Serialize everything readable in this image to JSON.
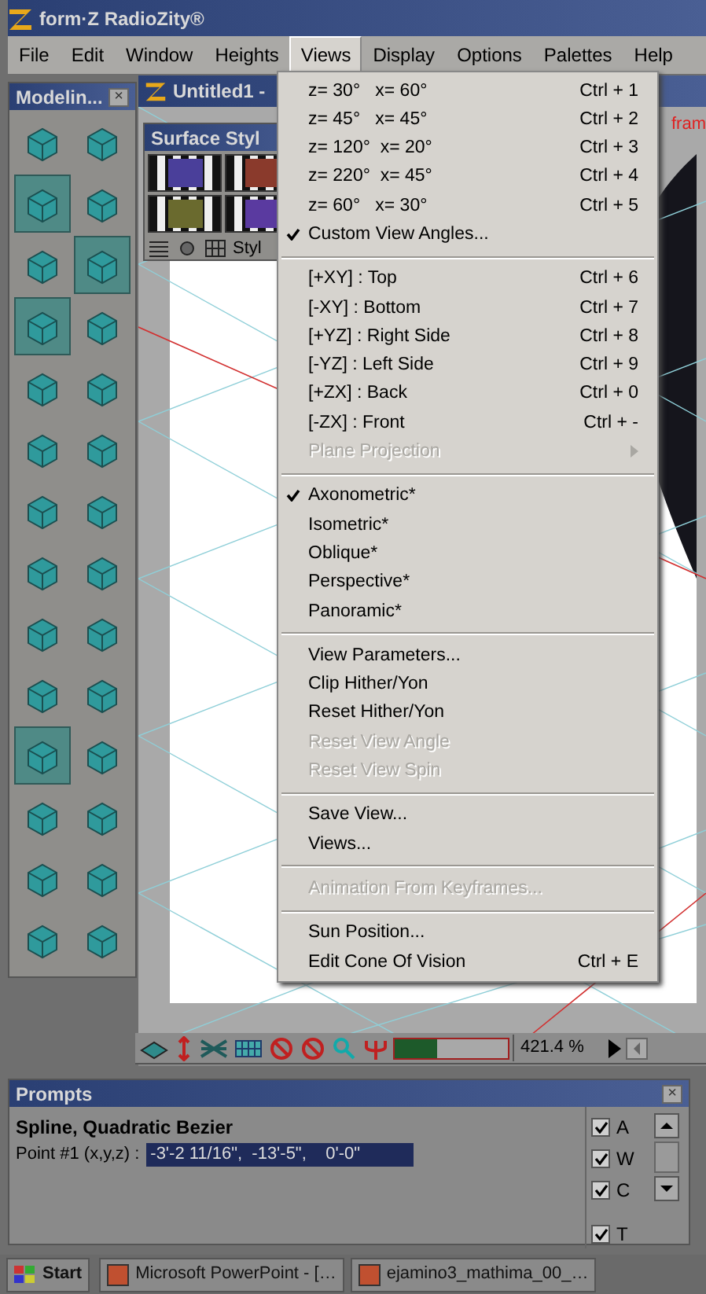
{
  "window": {
    "title": "form·Z RadioZity®"
  },
  "menubar": [
    {
      "label": "File",
      "selected": false
    },
    {
      "label": "Edit",
      "selected": false
    },
    {
      "label": "Window",
      "selected": false
    },
    {
      "label": "Heights",
      "selected": false
    },
    {
      "label": "Views",
      "selected": true
    },
    {
      "label": "Display",
      "selected": false
    },
    {
      "label": "Options",
      "selected": false
    },
    {
      "label": "Palettes",
      "selected": false
    },
    {
      "label": "Help",
      "selected": false
    }
  ],
  "tool_palette": {
    "title": "Modelin...",
    "close": "×",
    "tools": [
      {
        "selected": false
      },
      {
        "selected": false
      },
      {
        "selected": true
      },
      {
        "selected": false
      },
      {
        "selected": false
      },
      {
        "selected": true
      },
      {
        "selected": true
      },
      {
        "selected": false
      },
      {
        "selected": false
      },
      {
        "selected": false
      },
      {
        "selected": false
      },
      {
        "selected": false
      },
      {
        "selected": false
      },
      {
        "selected": false
      },
      {
        "selected": false
      },
      {
        "selected": false
      },
      {
        "selected": false
      },
      {
        "selected": false
      },
      {
        "selected": false
      },
      {
        "selected": false
      },
      {
        "selected": true
      },
      {
        "selected": false
      },
      {
        "selected": false
      },
      {
        "selected": false
      },
      {
        "selected": false
      },
      {
        "selected": false
      },
      {
        "selected": false
      },
      {
        "selected": false
      }
    ]
  },
  "document": {
    "title": "Untitled1 -",
    "label": "fram"
  },
  "surface_styles": {
    "title": "Surface Styl",
    "tab": "Styl",
    "swatches": [
      {
        "color": "#4a3f9a"
      },
      {
        "color": "#8a3a2c"
      },
      {
        "color": "#6a6a2e"
      },
      {
        "color": "#5a3aa0"
      }
    ]
  },
  "views_menu": [
    {
      "kind": "item",
      "label": "z= 30°   x= 60°",
      "shortcut": "Ctrl + 1",
      "checked": false,
      "disabled": false
    },
    {
      "kind": "item",
      "label": "z= 45°   x= 45°",
      "shortcut": "Ctrl + 2",
      "checked": false,
      "disabled": false
    },
    {
      "kind": "item",
      "label": "z= 120°  x= 20°",
      "shortcut": "Ctrl + 3",
      "checked": false,
      "disabled": false
    },
    {
      "kind": "item",
      "label": "z= 220°  x= 45°",
      "shortcut": "Ctrl + 4",
      "checked": false,
      "disabled": false
    },
    {
      "kind": "item",
      "label": "z= 60°   x= 30°",
      "shortcut": "Ctrl + 5",
      "checked": false,
      "disabled": false
    },
    {
      "kind": "item",
      "label": "Custom View Angles...",
      "checked": true,
      "disabled": false
    },
    {
      "kind": "separator"
    },
    {
      "kind": "item",
      "label": "[+XY] : Top",
      "shortcut": "Ctrl + 6",
      "checked": false,
      "disabled": false
    },
    {
      "kind": "item",
      "label": "[-XY] : Bottom",
      "shortcut": "Ctrl + 7",
      "checked": false,
      "disabled": false
    },
    {
      "kind": "item",
      "label": "[+YZ] : Right Side",
      "shortcut": "Ctrl + 8",
      "checked": false,
      "disabled": false
    },
    {
      "kind": "item",
      "label": "[-YZ] : Left Side",
      "shortcut": "Ctrl + 9",
      "checked": false,
      "disabled": false
    },
    {
      "kind": "item",
      "label": "[+ZX] : Back",
      "shortcut": "Ctrl + 0",
      "checked": false,
      "disabled": false
    },
    {
      "kind": "item",
      "label": "[-ZX] : Front",
      "shortcut": "Ctrl + -",
      "checked": false,
      "disabled": false
    },
    {
      "kind": "submenu",
      "label": "Plane Projection",
      "checked": false,
      "disabled": true
    },
    {
      "kind": "separator"
    },
    {
      "kind": "item",
      "label": "Axonometric*",
      "checked": true,
      "disabled": false
    },
    {
      "kind": "item",
      "label": "Isometric*",
      "checked": false,
      "disabled": false
    },
    {
      "kind": "item",
      "label": "Oblique*",
      "checked": false,
      "disabled": false
    },
    {
      "kind": "item",
      "label": "Perspective*",
      "checked": false,
      "disabled": false
    },
    {
      "kind": "item",
      "label": "Panoramic*",
      "checked": false,
      "disabled": false
    },
    {
      "kind": "separator"
    },
    {
      "kind": "item",
      "label": "View Parameters...",
      "checked": false,
      "disabled": false
    },
    {
      "kind": "item",
      "label": "Clip Hither/Yon",
      "checked": false,
      "disabled": false
    },
    {
      "kind": "item",
      "label": "Reset Hither/Yon",
      "checked": false,
      "disabled": false
    },
    {
      "kind": "item",
      "label": "Reset View Angle",
      "checked": false,
      "disabled": true
    },
    {
      "kind": "item",
      "label": "Reset View Spin",
      "checked": false,
      "disabled": true
    },
    {
      "kind": "separator"
    },
    {
      "kind": "item",
      "label": "Save View...",
      "checked": false,
      "disabled": false
    },
    {
      "kind": "item",
      "label": "Views...",
      "checked": false,
      "disabled": false
    },
    {
      "kind": "separator"
    },
    {
      "kind": "item",
      "label": "Animation From Keyframes...",
      "checked": false,
      "disabled": true
    },
    {
      "kind": "separator"
    },
    {
      "kind": "item",
      "label": "Sun Position...",
      "checked": false,
      "disabled": false
    },
    {
      "kind": "item",
      "label": "Edit Cone Of Vision",
      "shortcut": "Ctrl + E",
      "checked": false,
      "disabled": false
    }
  ],
  "status_toolbar": {
    "level": 0.38,
    "zoom": "421.4 %"
  },
  "prompts": {
    "title": "Prompts",
    "close": "×",
    "heading": "Spline, Quadratic Bezier",
    "label": "Point #1 (x,y,z) :",
    "value": "-3'-2 11/16\",  -13'-5\",    0'-0\"",
    "options": [
      {
        "label": "A",
        "checked": true
      },
      {
        "label": "W",
        "checked": true
      },
      {
        "label": "C",
        "checked": true
      },
      {
        "label": "T",
        "checked": true
      }
    ]
  },
  "taskbar": {
    "start": "Start",
    "tasks": [
      {
        "label": "Microsoft PowerPoint - […"
      },
      {
        "label": "ejamino3_mathima_00_…"
      }
    ]
  }
}
